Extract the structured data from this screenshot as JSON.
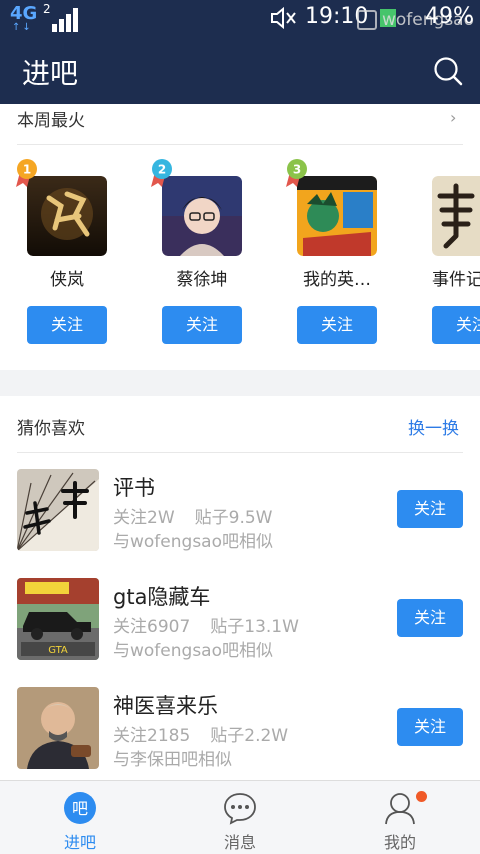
{
  "status_bar": {
    "network": "4G",
    "network_arrows": "↑↓",
    "sim_slot": "2",
    "time": "19:10",
    "watermark": "wofengsao",
    "battery": "49%"
  },
  "header": {
    "title": "进吧",
    "search_icon": "search-icon"
  },
  "hot_section": {
    "title": "本周最火",
    "more_icon": "chevron-right-icon",
    "more_glyph": "›",
    "items": [
      {
        "rank": "1",
        "name": "侠岚",
        "follow_label": "关注"
      },
      {
        "rank": "2",
        "name": "蔡徐坤",
        "follow_label": "关注"
      },
      {
        "rank": "3",
        "name": "我的英…",
        "follow_label": "关注"
      },
      {
        "rank": "",
        "name": "事件记",
        "follow_label": "关注"
      }
    ],
    "rank_colors": [
      "#f5a623",
      "#36b6e0",
      "#8bc34a"
    ]
  },
  "recommend_section": {
    "title": "猜你喜欢",
    "refresh_label": "换一换",
    "items": [
      {
        "name": "评书",
        "followers": "关注2W",
        "posts": "贴子9.5W",
        "similar": "与wofengsao吧相似",
        "follow_label": "关注"
      },
      {
        "name": "gta隐藏车",
        "followers": "关注6907",
        "posts": "贴子13.1W",
        "similar": "与wofengsao吧相似",
        "follow_label": "关注"
      },
      {
        "name": "神医喜来乐",
        "followers": "关注2185",
        "posts": "贴子2.2W",
        "similar": "与李保田吧相似",
        "follow_label": "关注"
      }
    ]
  },
  "bottom_nav": {
    "items": [
      {
        "label": "进吧",
        "icon": "ba-icon",
        "glyph": "吧",
        "active": true
      },
      {
        "label": "消息",
        "icon": "message-icon",
        "active": false
      },
      {
        "label": "我的",
        "icon": "profile-icon",
        "active": false,
        "has_badge": true
      }
    ]
  },
  "colors": {
    "header_bg": "#1d2d4f",
    "accent": "#2d8cf0",
    "badge": "#f05a28"
  }
}
